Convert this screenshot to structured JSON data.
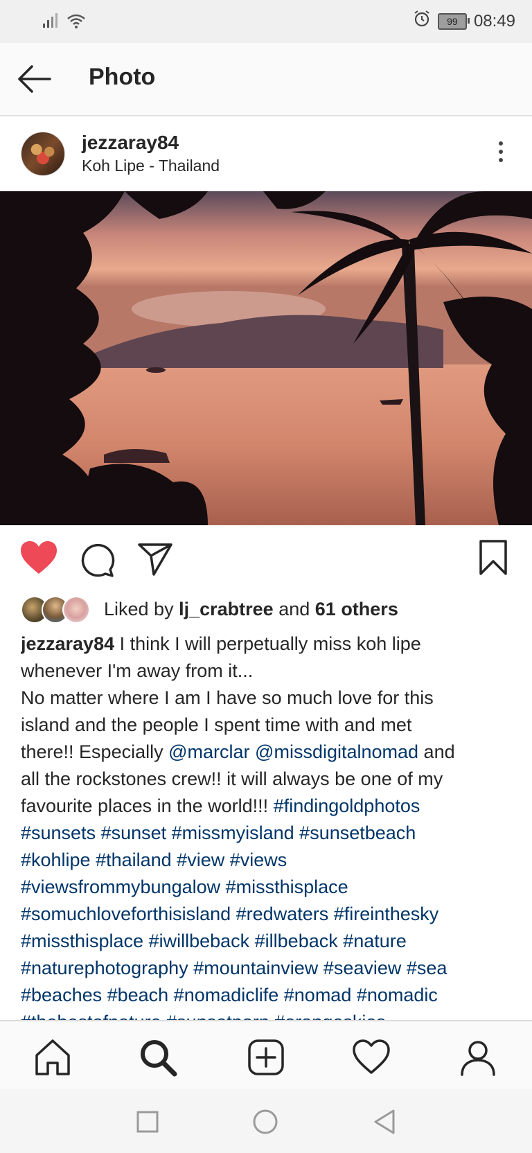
{
  "status_bar": {
    "time": "08:49",
    "battery": "99"
  },
  "header": {
    "title": "Photo"
  },
  "post": {
    "username": "jezzaray84",
    "location": "Koh Lipe - Thailand",
    "liked": true
  },
  "likes": {
    "prefix": "Liked by",
    "user": "lj_crabtree",
    "middle": "and",
    "others": "61 others"
  },
  "caption": {
    "lines": [
      [
        {
          "t": "jezzaray84",
          "k": "user"
        },
        {
          "t": " I think I will perpetually miss koh lipe",
          "k": "text"
        }
      ],
      [
        {
          "t": "whenever I'm away from it...",
          "k": "text"
        }
      ],
      [
        {
          "t": "No matter where I am I have so much love for this",
          "k": "text"
        }
      ],
      [
        {
          "t": "island and the people I spent time with and met",
          "k": "text"
        }
      ],
      [
        {
          "t": "there!! Especially ",
          "k": "text"
        },
        {
          "t": "@marclar",
          "k": "tag"
        },
        {
          "t": "  ",
          "k": "text"
        },
        {
          "t": "@missdigitalnomad",
          "k": "tag"
        },
        {
          "t": " and",
          "k": "text"
        }
      ],
      [
        {
          "t": "all the rockstones crew!! it will always be one of my",
          "k": "text"
        }
      ],
      [
        {
          "t": "favourite places in the world!!! ",
          "k": "text"
        },
        {
          "t": "#findingoldphotos",
          "k": "tag"
        }
      ],
      [
        {
          "t": "#sunsets #sunset #missmyisland #sunsetbeach",
          "k": "tag"
        }
      ],
      [
        {
          "t": "#kohlipe #thailand #view #views",
          "k": "tag"
        }
      ],
      [
        {
          "t": "#viewsfrommybungalow #missthisplace",
          "k": "tag"
        }
      ],
      [
        {
          "t": "#somuchloveforthisisland #redwaters #fireinthesky",
          "k": "tag"
        }
      ],
      [
        {
          "t": "#missthisplace #iwillbeback #illbeback #nature",
          "k": "tag"
        }
      ],
      [
        {
          "t": "#naturephotography #mountainview #seaview #sea",
          "k": "tag"
        }
      ],
      [
        {
          "t": "#beaches #beach #nomadiclife #nomad #nomadic",
          "k": "tag"
        }
      ],
      [
        {
          "t": "#thebestofnature #sunsetporn #orangeskies",
          "k": "tag"
        }
      ]
    ]
  },
  "colors": {
    "like_red": "#ed4956",
    "hashtag": "#003569",
    "text": "#262626"
  },
  "icons": {
    "status_left": [
      "signal-icon",
      "wifi-icon"
    ],
    "status_right": [
      "alarm-icon",
      "battery-icon"
    ],
    "header": [
      "back-arrow-icon"
    ],
    "post": [
      "more-options-icon"
    ],
    "actions": [
      "heart-filled-icon",
      "comment-icon",
      "share-icon",
      "bookmark-icon"
    ],
    "bottom_nav": [
      "home-icon",
      "search-icon",
      "new-post-icon",
      "activity-heart-icon",
      "profile-icon"
    ],
    "system_nav": [
      "recents-square-icon",
      "home-circle-icon",
      "back-triangle-icon"
    ]
  }
}
